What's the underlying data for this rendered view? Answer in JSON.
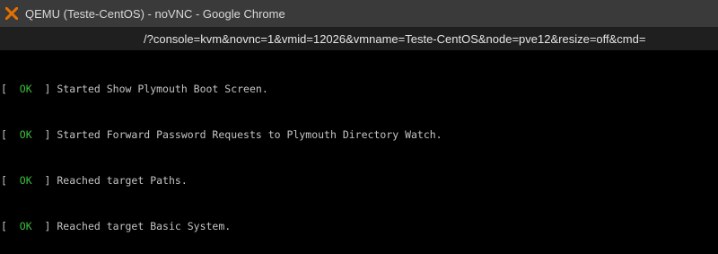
{
  "window": {
    "title": "QEMU (Teste-CentOS) - noVNC - Google Chrome"
  },
  "address_bar": {
    "url": "/?console=kvm&novnc=1&vmid=12026&vmname=Teste-CentOS&node=pve12&resize=off&cmd="
  },
  "console": {
    "lines": [
      {
        "open": "[  ",
        "status": "OK",
        "close": "  ] ",
        "message": "Started Show Plymouth Boot Screen."
      },
      {
        "open": "[  ",
        "status": "OK",
        "close": "  ] ",
        "message": "Started Forward Password Requests to Plymouth Directory Watch."
      },
      {
        "open": "[  ",
        "status": "OK",
        "close": "  ] ",
        "message": "Reached target Paths."
      },
      {
        "open": "[  ",
        "status": "OK",
        "close": "  ] ",
        "message": "Reached target Basic System."
      }
    ]
  },
  "icons": {
    "app_icon": "proxmox-x-icon"
  },
  "colors": {
    "titlebar_bg": "#3a3a3a",
    "console_bg": "#000000",
    "console_text": "#c4c4c4",
    "ok_green": "#3dbf3d",
    "icon_orange": "#e57000"
  }
}
